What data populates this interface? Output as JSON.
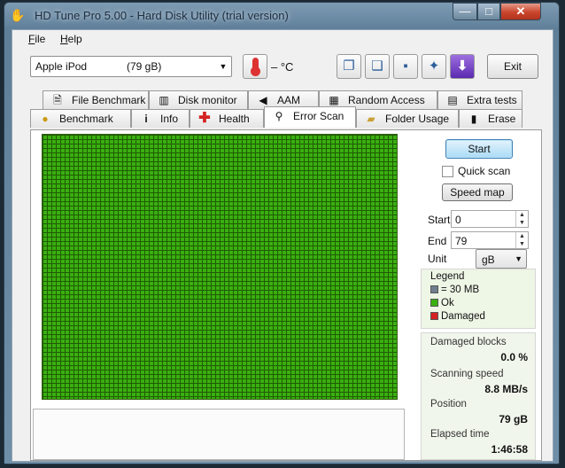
{
  "window": {
    "title": "HD Tune Pro 5.00 - Hard Disk Utility (trial version)",
    "controls": {
      "minimize": "—",
      "maximize": "□",
      "close": "✕"
    }
  },
  "menu": {
    "file": "File",
    "help": "Help"
  },
  "toolbar": {
    "drive_name": "Apple  iPod",
    "drive_size": "(79 gB)",
    "temperature": "– °C",
    "exit_label": "Exit",
    "icons": [
      "copy-info-icon",
      "copy-screen-icon",
      "save-icon",
      "settings-icon",
      "download-icon"
    ]
  },
  "tabs": {
    "row1": [
      {
        "label": "File Benchmark",
        "icon": "document-icon"
      },
      {
        "label": "Disk monitor",
        "icon": "chart-icon"
      },
      {
        "label": "AAM",
        "icon": "speaker-icon"
      },
      {
        "label": "Random Access",
        "icon": "grid-icon"
      },
      {
        "label": "Extra tests",
        "icon": "clipboard-icon"
      }
    ],
    "row2": [
      {
        "label": "Benchmark",
        "icon": "bulb-icon"
      },
      {
        "label": "Info",
        "icon": "info-icon"
      },
      {
        "label": "Health",
        "icon": "cross-icon"
      },
      {
        "label": "Error Scan",
        "icon": "magnifier-icon",
        "active": true
      },
      {
        "label": "Folder Usage",
        "icon": "folder-icon"
      },
      {
        "label": "Erase",
        "icon": "trash-icon"
      }
    ]
  },
  "controls": {
    "start_label": "Start",
    "quick_scan_label": "Quick scan",
    "quick_scan_checked": false,
    "speed_map_label": "Speed map",
    "start_field_label": "Start",
    "start_value": "0",
    "end_field_label": "End",
    "end_value": "79",
    "unit_label": "Unit",
    "unit_value": "gB"
  },
  "legend": {
    "title": "Legend",
    "block_size": "= 30 MB",
    "ok": "Ok",
    "damaged": "Damaged",
    "colors": {
      "block": "#6f7f8f",
      "ok": "#3aaf10",
      "damaged": "#d42222"
    }
  },
  "stats": {
    "damaged_blocks_label": "Damaged blocks",
    "damaged_blocks_value": "0.0 %",
    "scanning_speed_label": "Scanning speed",
    "scanning_speed_value": "8.8 MB/s",
    "position_label": "Position",
    "position_value": "79 gB",
    "elapsed_time_label": "Elapsed time",
    "elapsed_time_value": "1:46:58"
  },
  "scan_grid": {
    "status": "all blocks ok",
    "color": "#3aaf10"
  }
}
